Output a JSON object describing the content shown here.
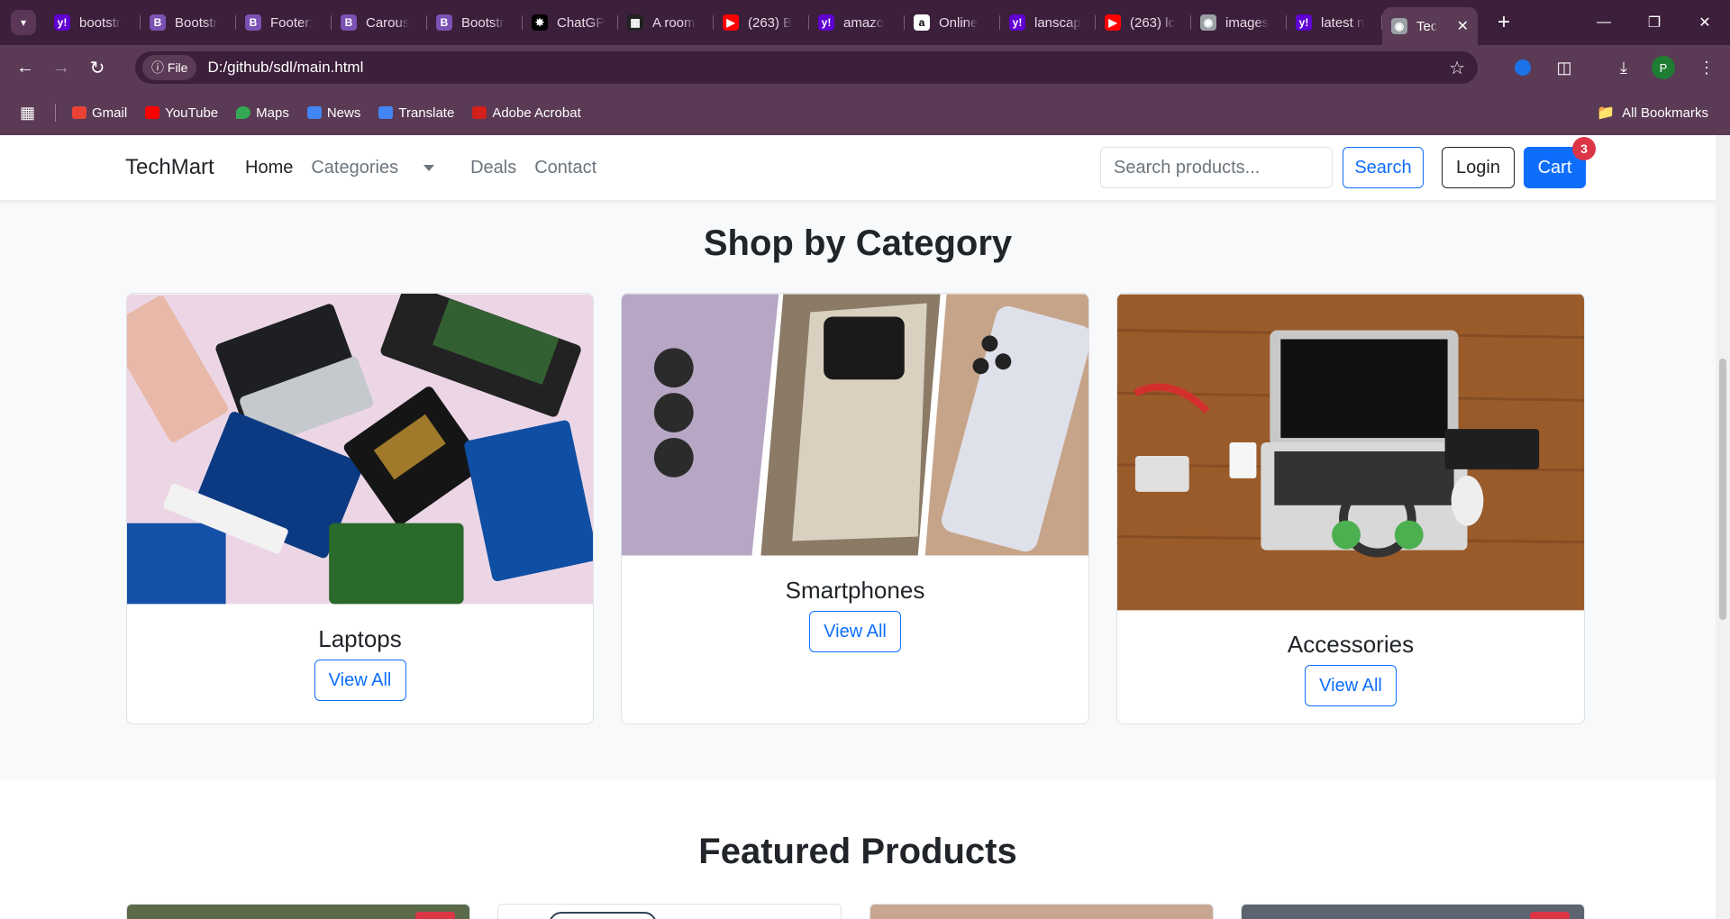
{
  "browser": {
    "tabs": [
      {
        "title": "bootstr",
        "icon": "yahoo-icon"
      },
      {
        "title": "Bootstr",
        "icon": "bootstrap-icon"
      },
      {
        "title": "Footer:",
        "icon": "bootstrap-icon"
      },
      {
        "title": "Carous",
        "icon": "bootstrap-icon"
      },
      {
        "title": "Bootstr",
        "icon": "bootstrap-icon"
      },
      {
        "title": "ChatGP",
        "icon": "chatgpt-icon"
      },
      {
        "title": "A room",
        "icon": "image-icon"
      },
      {
        "title": "(263) B",
        "icon": "youtube-icon"
      },
      {
        "title": "amazo",
        "icon": "yahoo-icon"
      },
      {
        "title": "Online",
        "icon": "amazon-icon"
      },
      {
        "title": "lanscap",
        "icon": "yahoo-icon"
      },
      {
        "title": "(263) lc",
        "icon": "youtube-icon"
      },
      {
        "title": "images",
        "icon": "globe-icon"
      },
      {
        "title": "latest n",
        "icon": "yahoo-icon"
      },
      {
        "title": "Tec",
        "icon": "globe-icon",
        "active": true
      }
    ],
    "address": {
      "chip": "File",
      "url": "D:/github/sdl/main.html"
    },
    "profile_initial": "P",
    "bookmarks": [
      "Gmail",
      "YouTube",
      "Maps",
      "News",
      "Translate",
      "Adobe Acrobat"
    ],
    "all_bookmarks": "All Bookmarks"
  },
  "navbar": {
    "brand": "TechMart",
    "links": {
      "home": "Home",
      "categories": "Categories",
      "deals": "Deals",
      "contact": "Contact"
    },
    "search_placeholder": "Search products...",
    "search_button": "Search",
    "login_button": "Login",
    "cart_button": "Cart",
    "cart_count": "3"
  },
  "categories_section": {
    "title": "Shop by Category",
    "cards": [
      {
        "name": "Laptops",
        "button": "View All"
      },
      {
        "name": "Smartphones",
        "button": "View All"
      },
      {
        "name": "Accessories",
        "button": "View All"
      }
    ]
  },
  "featured_section": {
    "title": "Featured Products"
  },
  "colors": {
    "primary": "#0d6efd",
    "badge": "#dc3545",
    "chrome": "#3c1f3a"
  }
}
